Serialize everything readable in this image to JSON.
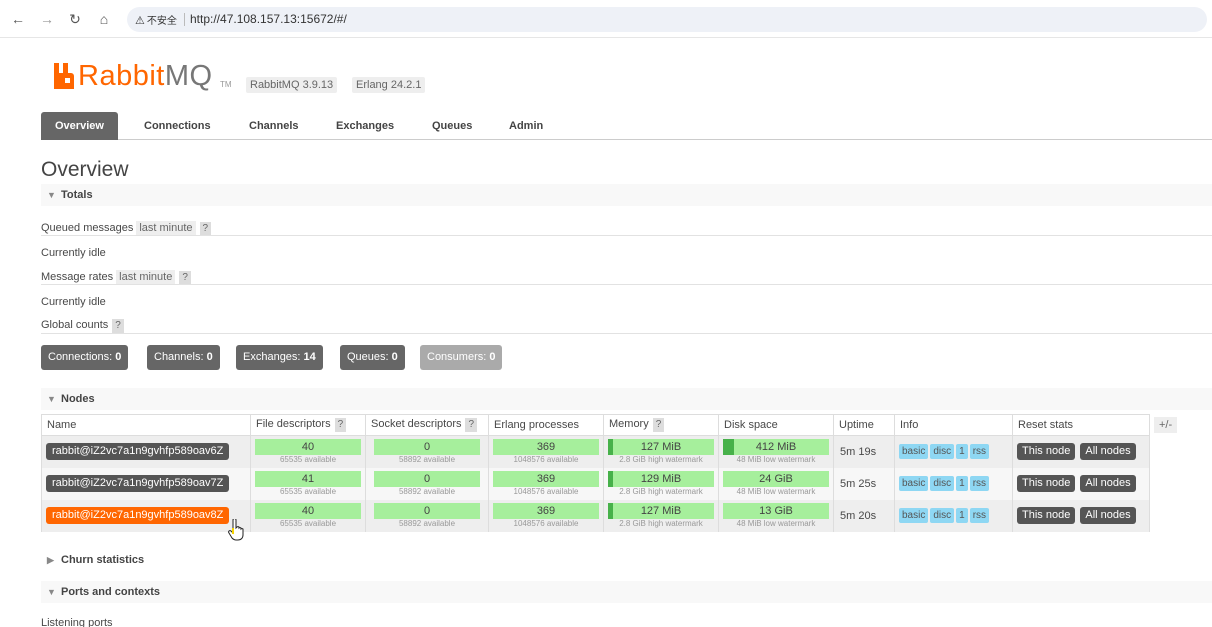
{
  "browser": {
    "back_icon": "arrow-left-icon",
    "forward_icon": "arrow-right-icon",
    "reload_icon": "reload-icon",
    "home_icon": "home-icon",
    "security_label": "不安全",
    "url": "http://47.108.157.13:15672/#/"
  },
  "header": {
    "logo_rabbit": "Rabbit",
    "logo_mq": "MQ",
    "logo_tm": "TM",
    "version": "RabbitMQ 3.9.13",
    "erlang": "Erlang 24.2.1",
    "brand_color": "#ff6600"
  },
  "tabs": [
    {
      "label": "Overview",
      "active": true
    },
    {
      "label": "Connections"
    },
    {
      "label": "Channels"
    },
    {
      "label": "Exchanges"
    },
    {
      "label": "Queues"
    },
    {
      "label": "Admin"
    }
  ],
  "page_title": "Overview",
  "totals": {
    "header": "Totals",
    "queued_messages_label": "Queued messages",
    "queued_messages_range": "last minute",
    "help": "?",
    "idle_1": "Currently idle",
    "message_rates_label": "Message rates",
    "message_rates_range": "last minute",
    "idle_2": "Currently idle",
    "global_counts_label": "Global counts"
  },
  "counts": [
    {
      "label": "Connections:",
      "value": "0"
    },
    {
      "label": "Channels:",
      "value": "0"
    },
    {
      "label": "Exchanges:",
      "value": "14"
    },
    {
      "label": "Queues:",
      "value": "0"
    },
    {
      "label": "Consumers:",
      "value": "0"
    }
  ],
  "nodes": {
    "header": "Nodes",
    "plus_minus": "+/-",
    "columns": [
      "Name",
      "File descriptors",
      "Socket descriptors",
      "Erlang processes",
      "Memory",
      "Disk space",
      "Uptime",
      "Info",
      "Reset stats"
    ],
    "rows": [
      {
        "name": "rabbit@iZ2vc7a1n9gvhfp589oav6Z",
        "fd": "40",
        "fd_avail": "65535 available",
        "sd": "0",
        "sd_avail": "58892 available",
        "ep": "369",
        "ep_avail": "1048576 available",
        "mem": "127 MiB",
        "mem_wm": "2.8 GiB high watermark",
        "mem_level": 0.044,
        "disk": "412 MiB",
        "disk_wm": "48 MiB low watermark",
        "disk_level": 0.1,
        "uptime": "5m 19s",
        "info": [
          "basic",
          "disc",
          "1",
          "rss"
        ],
        "reset": [
          "This node",
          "All nodes"
        ]
      },
      {
        "name": "rabbit@iZ2vc7a1n9gvhfp589oav7Z",
        "fd": "41",
        "fd_avail": "65535 available",
        "sd": "0",
        "sd_avail": "58892 available",
        "ep": "369",
        "ep_avail": "1048576 available",
        "mem": "129 MiB",
        "mem_wm": "2.8 GiB high watermark",
        "mem_level": 0.045,
        "disk": "24 GiB",
        "disk_wm": "48 MiB low watermark",
        "disk_level": 0,
        "uptime": "5m 25s",
        "info": [
          "basic",
          "disc",
          "1",
          "rss"
        ],
        "reset": [
          "This node",
          "All nodes"
        ]
      },
      {
        "name": "rabbit@iZ2vc7a1n9gvhfp589oav8Z",
        "fd": "40",
        "fd_avail": "65535 available",
        "sd": "0",
        "sd_avail": "58892 available",
        "ep": "369",
        "ep_avail": "1048576 available",
        "mem": "127 MiB",
        "mem_wm": "2.8 GiB high watermark",
        "mem_level": 0.044,
        "disk": "13 GiB",
        "disk_wm": "48 MiB low watermark",
        "disk_level": 0,
        "uptime": "5m 20s",
        "info": [
          "basic",
          "disc",
          "1",
          "rss"
        ],
        "reset": [
          "This node",
          "All nodes"
        ],
        "selected": true
      }
    ]
  },
  "churn": {
    "header": "Churn statistics"
  },
  "ports": {
    "header": "Ports and contexts",
    "listening_label": "Listening ports"
  }
}
